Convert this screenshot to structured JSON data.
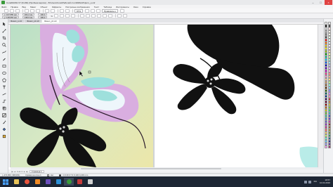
{
  "window": {
    "title": "CorelDRAW X7 (64-Bit) (Пробная версия) - B:\\Users\\Corel\\Рабочий стол\\ФИНАЛ\\фото_p.cdr",
    "minimize": "–",
    "maximize": "□",
    "close": "×"
  },
  "menu": [
    "Файл",
    "Правка",
    "Вид",
    "Макет",
    "Объект",
    "Эффекты",
    "Растровые изображения",
    "Текст",
    "Таблица",
    "Инструменты",
    "Окно",
    "Справка"
  ],
  "toolbar": {
    "zoom": "97%",
    "snap_label": "Привязать к"
  },
  "propbar": {
    "x": "x: 167,555 мм",
    "y": "y: 148,063 мм",
    "w": "203,2 мм",
    "h": "148,0 мм",
    "scale_w": "100,0",
    "scale_h": "100,0",
    "percent": "%"
  },
  "doctabs": [
    {
      "label": "Финал_p.cdr"
    },
    {
      "label": "Финал_p2.cdr"
    },
    {
      "label": "Финал_p3.cdr",
      "active": true
    }
  ],
  "pagebar": {
    "first": "|◂",
    "prev": "◂",
    "counter": "1 из 1",
    "next": "▸",
    "last": "▸|",
    "page_tab": "Страница 1"
  },
  "status": {
    "coords": "(−272,863; 398,081)",
    "info": "Кривая на слое 1",
    "fill_label": "Нет",
    "outline_label": "C:0 M:0 Y:0 K:100  0,200 mm"
  },
  "taskbar": {
    "time": "18:57",
    "date": "10.04.2016",
    "lang": "RU"
  },
  "colors": {
    "accent_green": "#3a9a3a",
    "taskbar_bg": "#1d2634",
    "wing_pink": "#d9aee0",
    "wing_teal": "#9ee0dc",
    "wing_white": "#eef6fb",
    "silhouette": "#111111"
  },
  "icons": {
    "pick_tool": "pick-tool-icon",
    "shape_tool": "shape-tool-icon",
    "crop_tool": "crop-tool-icon",
    "zoom_tool": "zoom-tool-icon",
    "freehand_tool": "freehand-tool-icon",
    "rect_tool": "rectangle-tool-icon",
    "ellipse_tool": "ellipse-tool-icon",
    "polygon_tool": "polygon-tool-icon",
    "text_tool": "text-tool-icon",
    "fill_tool": "fill-tool-icon",
    "eyedropper_tool": "eyedropper-tool-icon"
  }
}
